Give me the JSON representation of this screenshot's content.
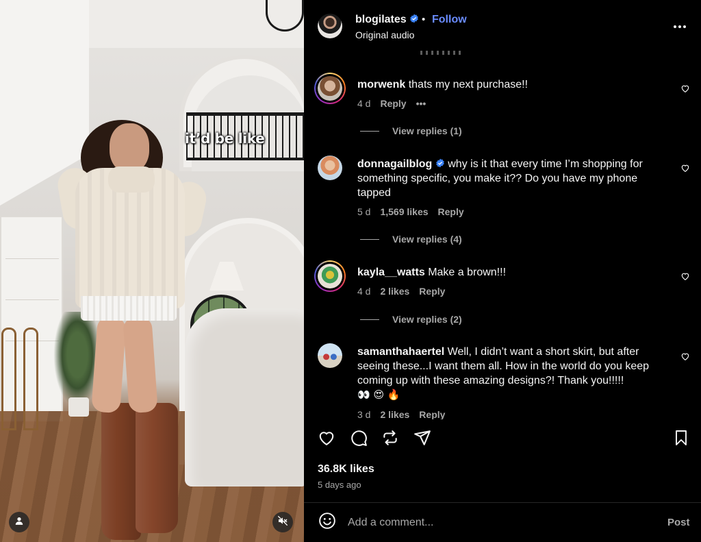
{
  "media": {
    "caption": "it’d be like",
    "user_icon": "user-icon",
    "mute_icon": "speaker-muted-icon"
  },
  "header": {
    "username": "blogilates",
    "separator": "•",
    "follow_label": "Follow",
    "audio_label": "Original audio",
    "more_icon": "more-icon"
  },
  "comments": [
    {
      "username": "morwenk",
      "text": "thats my next purchase!!",
      "time": "4 d",
      "likes": "",
      "reply_label": "Reply",
      "more": "•••",
      "view_replies": "View replies (1)"
    },
    {
      "username": "donnagailblog",
      "verified": true,
      "text": "why is it that every time I’m shopping for something specific, you make it?? Do you have my phone tapped",
      "time": "5 d",
      "likes": "1,569 likes",
      "reply_label": "Reply",
      "view_replies": "View replies (4)"
    },
    {
      "username": "kayla__watts",
      "text": "Make a brown!!!",
      "time": "4 d",
      "likes": "2 likes",
      "reply_label": "Reply",
      "view_replies": "View replies (2)"
    },
    {
      "username": "samanthahaertel",
      "text": "Well, I didn’t want a short skirt, but after seeing these...I want them all. How in the world do you keep coming up with these amazing designs?! Thank you!!!!!",
      "emojis": "👀 😍 🔥",
      "time": "3 d",
      "likes": "2 likes",
      "reply_label": "Reply"
    }
  ],
  "actions": {
    "like_icon": "heart-icon",
    "comment_icon": "comment-icon",
    "repost_icon": "repost-icon",
    "share_icon": "send-icon",
    "save_icon": "bookmark-icon"
  },
  "stats": {
    "likes": "36.8K likes",
    "posted": "5 days ago"
  },
  "comment_box": {
    "placeholder": "Add a comment...",
    "post_label": "Post"
  },
  "colors": {
    "follow": "#6a8cff",
    "verified": "#3b82f6",
    "muted_text": "#a8a8a8",
    "background": "#000000"
  }
}
